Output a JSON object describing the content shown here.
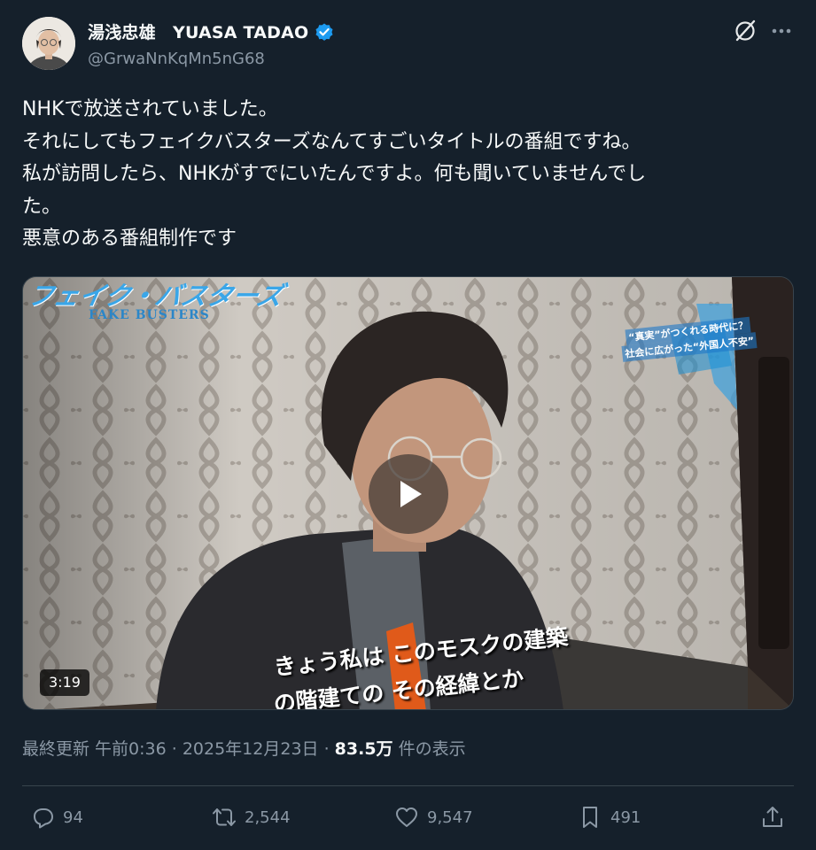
{
  "author": {
    "display_name": "湯浅忠雄　YUASA TADAO",
    "handle": "@GrwaNnKqMn5nG68",
    "verified": true,
    "verified_color": "#1d9bf0"
  },
  "tweet": {
    "lines": [
      "NHKで放送されていました。",
      "それにしてもフェイクバスターズなんてすごいタイトルの番組ですね。",
      "私が訪問したら、NHKがすでにいたんですよ。何も聞いていませんでし",
      "た。",
      "悪意のある番組制作です"
    ]
  },
  "media": {
    "type": "video",
    "duration": "3:19",
    "program_title": "フェイク・バスターズ",
    "program_subtitle": "FAKE BUSTERS",
    "caption_top_1": "“真実”がつくれる時代に？",
    "caption_top_2": "社会に広がった“外国人不安”",
    "subtitle_line_1": "きょう私は このモスクの建築",
    "subtitle_line_2": "の階建ての その経緯とか"
  },
  "meta": {
    "prefix": "最終更新 午前0:36 · 2025年12月23日 · ",
    "views": "83.5万",
    "views_suffix": " 件の表示"
  },
  "actions": {
    "replies": "94",
    "reposts": "2,544",
    "likes": "9,547",
    "bookmarks": "491"
  },
  "icons": [
    "grok-icon",
    "more-icon",
    "reply-icon",
    "repost-icon",
    "like-icon",
    "bookmark-icon",
    "share-icon",
    "play-icon",
    "verified-icon"
  ],
  "colors": {
    "background": "#15202b",
    "text": "#f7f9f9",
    "muted": "#8b98a5",
    "border": "#38444d"
  }
}
